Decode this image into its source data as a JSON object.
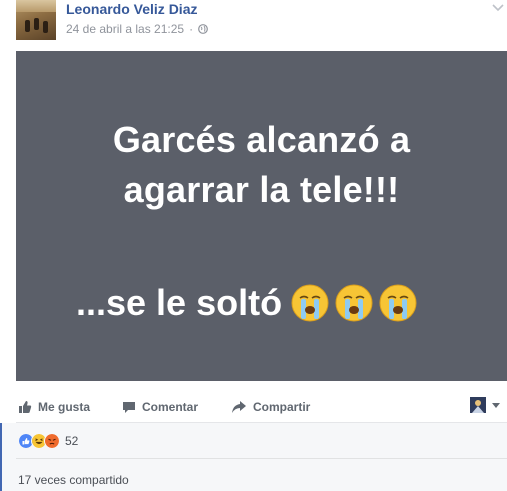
{
  "post": {
    "author": "Leonardo Veliz Diaz",
    "timestamp": "24 de abril a las 21:25",
    "separator": "·",
    "privacy_icon": "globe-icon",
    "menu_icon": "chevron-down-icon"
  },
  "media": {
    "line1": "Garcés alcanzó a",
    "line2": "agarrar la tele!!!",
    "line3": "...se le soltó",
    "emoji": [
      "crying-face-emoji",
      "crying-face-emoji",
      "crying-face-emoji"
    ],
    "background_color": "#5b5f69"
  },
  "actions": {
    "like_label": "Me gusta",
    "comment_label": "Comentar",
    "share_label": "Compartir"
  },
  "feedback": {
    "reactions": [
      "like-reaction-icon",
      "haha-reaction-icon",
      "angry-reaction-icon"
    ],
    "reaction_count": "52",
    "shares_text": "17 veces compartido"
  },
  "colors": {
    "author_link": "#365899",
    "like_blue": "#4267b2",
    "muted_text": "#90949c",
    "action_text": "#606770"
  }
}
